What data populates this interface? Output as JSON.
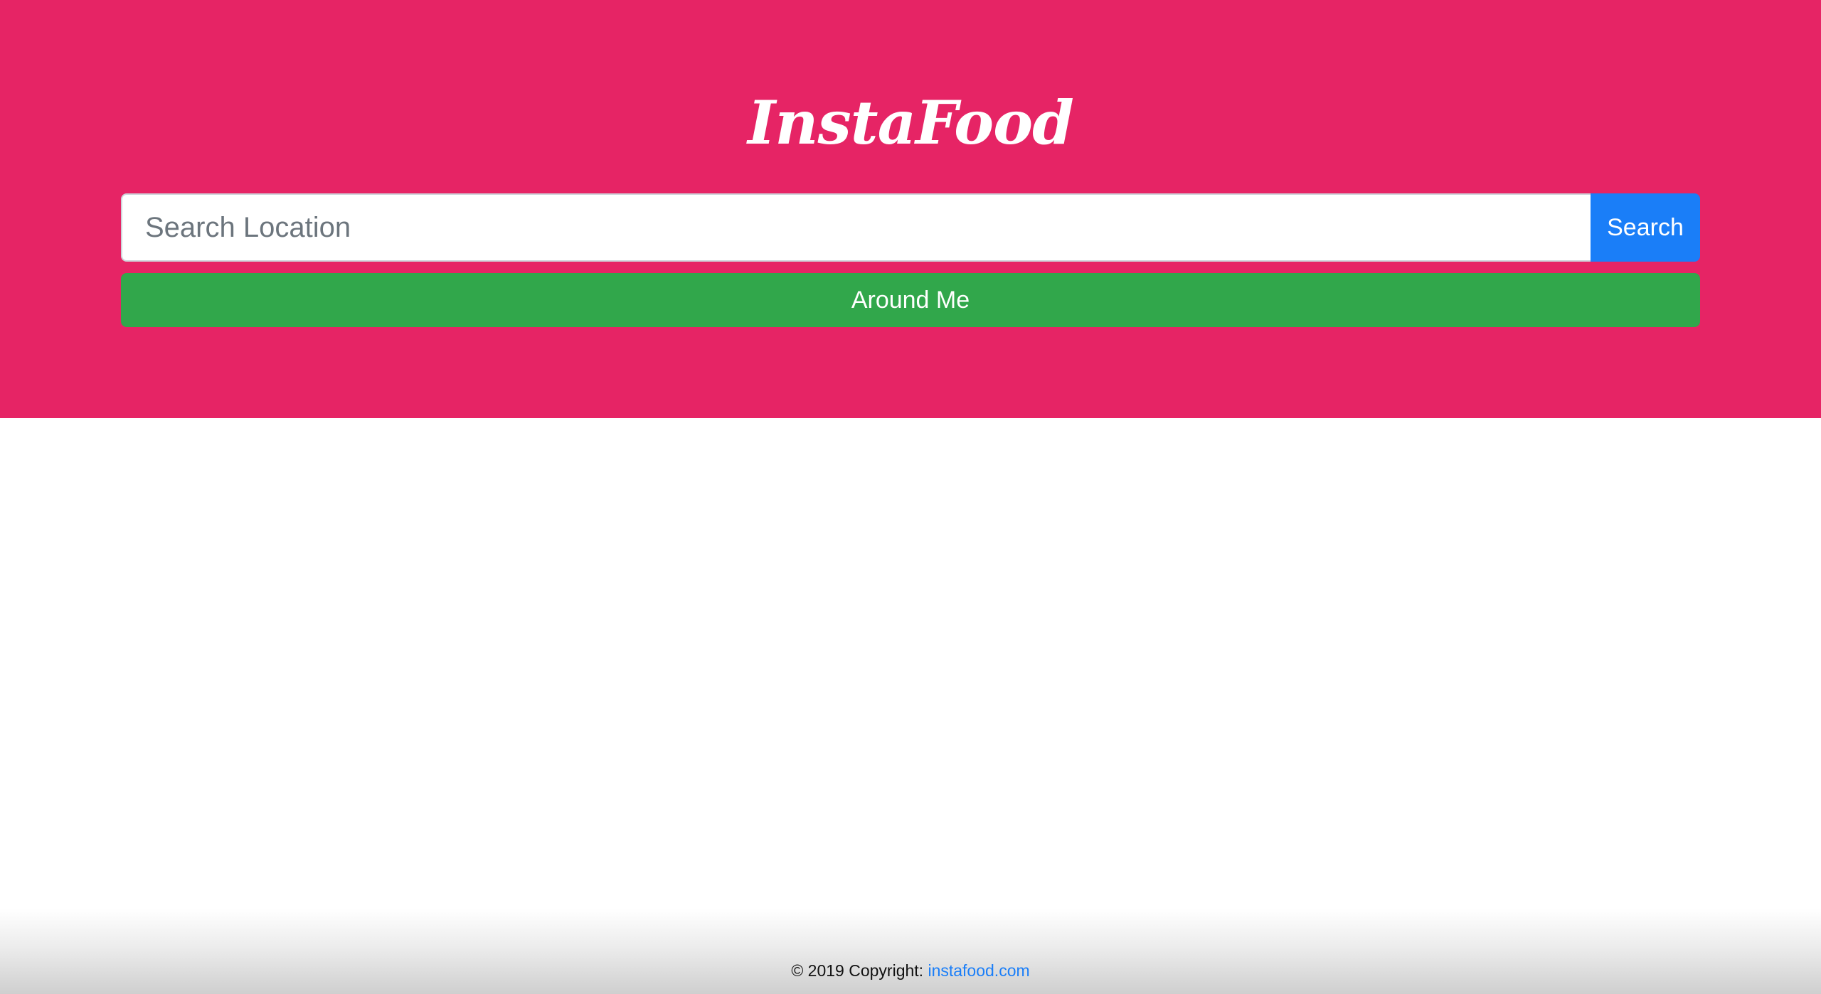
{
  "header": {
    "brand": "InstaFood",
    "search": {
      "placeholder": "Search Location",
      "value": "",
      "button_label": "Search"
    },
    "around_me_label": "Around Me"
  },
  "footer": {
    "copyright": "© 2019 Copyright:",
    "link_text": "instafood.com"
  },
  "colors": {
    "hero_background": "#e62465",
    "search_button": "#1a7ef8",
    "around_me_button": "#31a74b",
    "link": "#1a7ef8"
  }
}
